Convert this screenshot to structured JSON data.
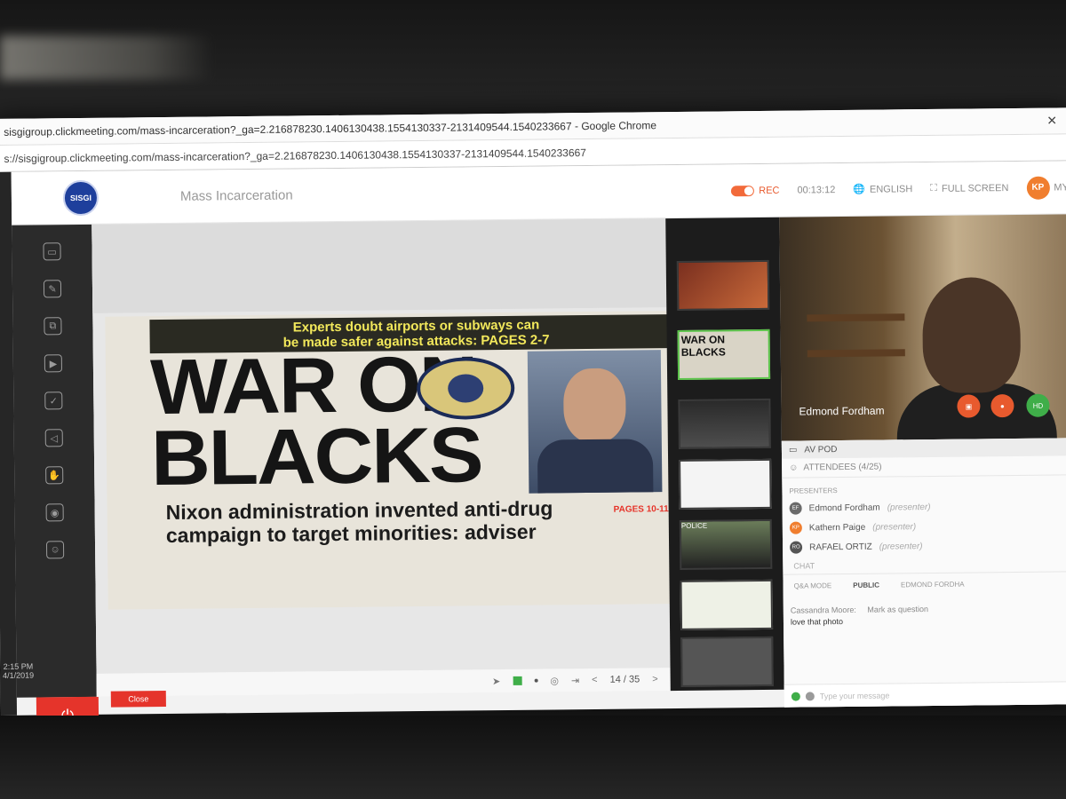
{
  "window": {
    "title": "sisgigroup.clickmeeting.com/mass-incarceration?_ga=2.216878230.1406130438.1554130337-2131409544.1540233667 - Google Chrome",
    "url": "s://sisgigroup.clickmeeting.com/mass-incarceration?_ga=2.216878230.1406130438.1554130337-2131409544.1540233667"
  },
  "header": {
    "logo_text": "SISGI",
    "title": "Mass Incarceration",
    "rec_label": "REC",
    "timer": "00:13:12",
    "language": "ENGLISH",
    "fullscreen": "FULL SCREEN",
    "avatar_initials": "KP",
    "user_label": "MY"
  },
  "clock": {
    "time": "2:15 PM",
    "date": "4/1/2019"
  },
  "slide": {
    "top_line1": "Experts doubt airports or subways can",
    "top_line2": "be made safer against attacks: PAGES 2-7",
    "headline1": "WAR ON",
    "headline2": "BLACKS",
    "sub1": "Nixon administration invented anti-drug",
    "sub2": "campaign to target minorities: adviser",
    "pages": "PAGES 10-11"
  },
  "slide_toolbar": {
    "page": "14 / 35",
    "prev": "<",
    "next": ">"
  },
  "close_button": "Close",
  "thumbnails": [
    {
      "caption": ""
    },
    {
      "caption": "WAR ON BLACKS"
    },
    {
      "caption": ""
    },
    {
      "caption": ""
    },
    {
      "caption": "POLICE"
    },
    {
      "caption": ""
    },
    {
      "caption": ""
    }
  ],
  "video": {
    "name": "Edmond Fordham",
    "hd": "HD"
  },
  "panel": {
    "avpod": "AV POD",
    "attendees": "ATTENDEES (4/25)",
    "presenters_label": "PRESENTERS",
    "presenters": [
      {
        "initials": "EF",
        "name": "Edmond Fordham",
        "role": "(presenter)",
        "color": "#6a6a6a"
      },
      {
        "initials": "KP",
        "name": "Kathern Paige",
        "role": "(presenter)",
        "color": "#f07e2f"
      },
      {
        "initials": "RO",
        "name": "RAFAEL ORTIZ",
        "role": "(presenter)",
        "color": "#555555"
      }
    ],
    "chat_label": "CHAT",
    "tabs": [
      "Q&A MODE",
      "PUBLIC",
      "EDMOND FORDHA"
    ],
    "msg_meta": "Cassandra Moore:",
    "msg_mark": "Mark as question",
    "msg_text": "love that photo",
    "input_placeholder": "Type your message"
  },
  "colors": {
    "accent": "#f26a3a",
    "rec": "#e85a2e",
    "power": "#e5342b",
    "selected_thumb": "#5bc44a"
  }
}
